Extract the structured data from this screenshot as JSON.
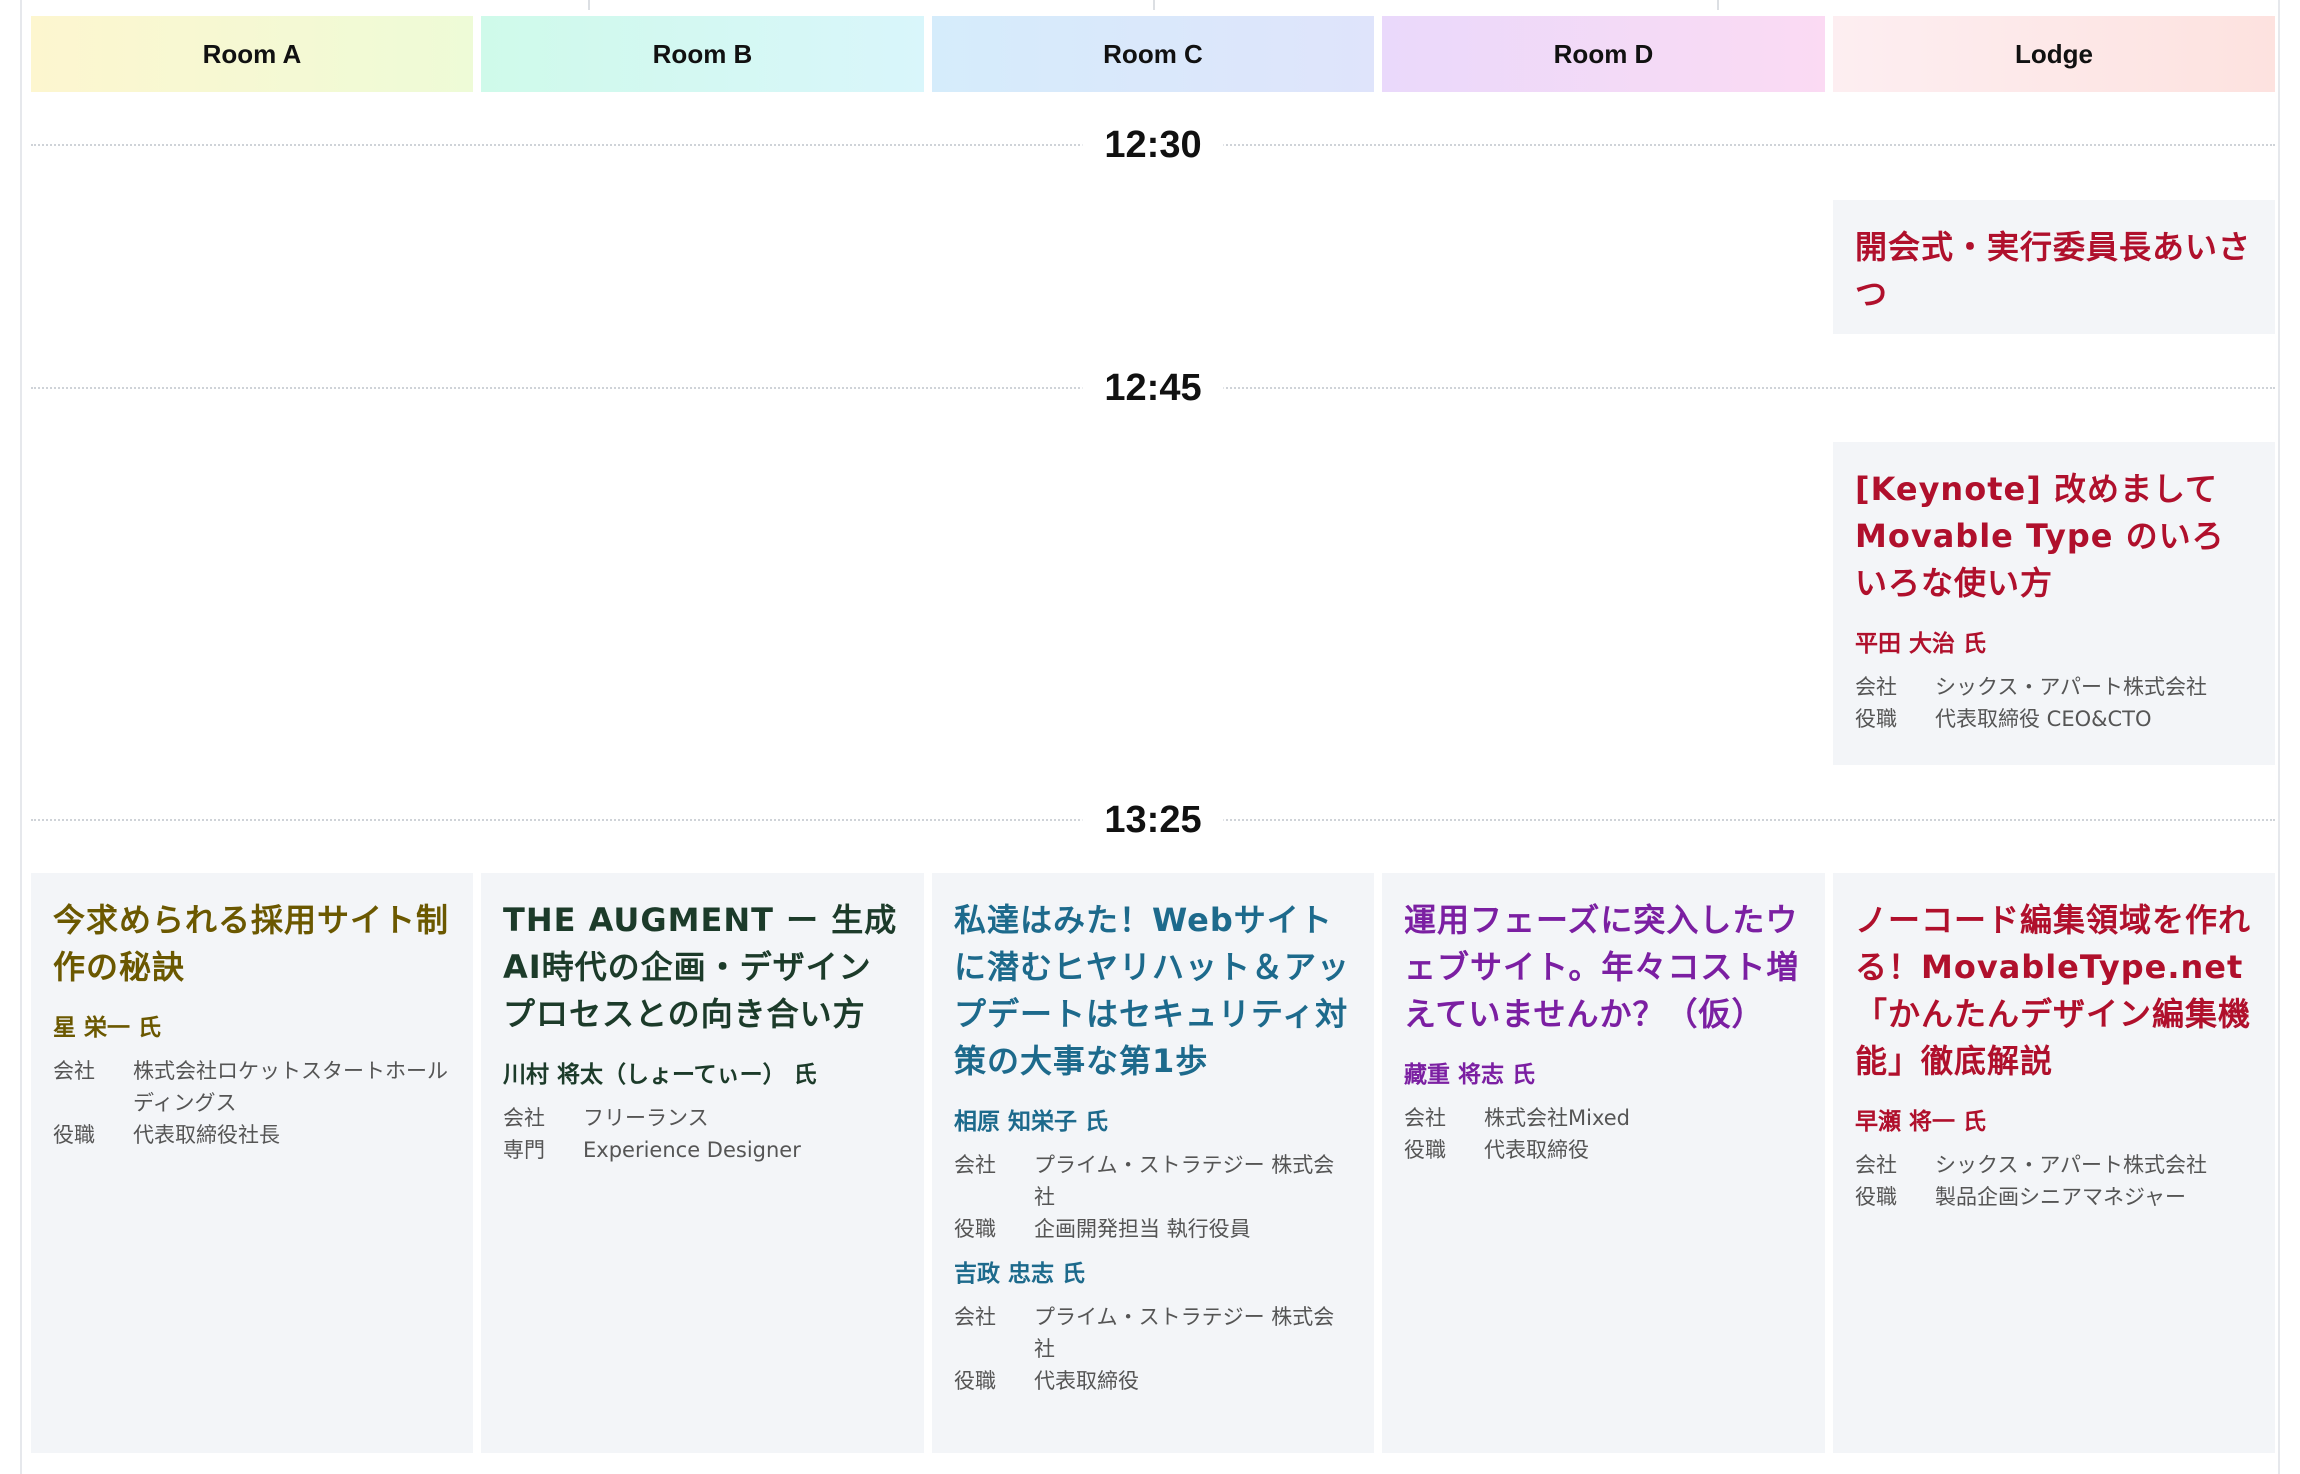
{
  "rooms": [
    "Room A",
    "Room B",
    "Room C",
    "Room D",
    "Lodge"
  ],
  "times": {
    "t1": "12:30",
    "t2": "12:45",
    "t3": "13:25"
  },
  "labels": {
    "company": "会社",
    "position": "役職",
    "specialty": "専門"
  },
  "sessions": {
    "opening": {
      "room": "Lodge",
      "title": "開会式・実行委員長あいさつ"
    },
    "keynote": {
      "room": "Lodge",
      "title": "[Keynote] 改めまして Movable Type のいろいろな使い方",
      "speaker": "平田 大治 氏",
      "company": "シックス・アパート株式会社",
      "position": "代表取締役 CEO&CTO"
    },
    "room_a": {
      "title": "今求められる採用サイト制作の秘訣",
      "speaker": "星 栄一 氏",
      "company": "株式会社ロケットスタートホールディングス",
      "position": "代表取締役社長"
    },
    "room_b": {
      "title": "THE AUGMENT ー 生成AI時代の企画・デザインプロセスとの向き合い方",
      "speaker": "川村 将太（しょーてぃー） 氏",
      "company": "フリーランス",
      "specialty": "Experience Designer"
    },
    "room_c": {
      "title": "私達はみた！Webサイトに潜むヒヤリハット＆アップデートはセキュリティ対策の大事な第1歩",
      "speakers": [
        {
          "name": "相原 知栄子 氏",
          "company": "プライム・ストラテジー 株式会社",
          "position": "企画開発担当 執行役員"
        },
        {
          "name": "吉政 忠志 氏",
          "company": "プライム・ストラテジー 株式会社",
          "position": "代表取締役"
        }
      ]
    },
    "room_d": {
      "title": "運用フェーズに突入したウェブサイト。年々コスト増えていませんか？（仮）",
      "speaker": "藏重 将志 氏",
      "company": "株式会社Mixed",
      "position": "代表取締役"
    },
    "lodge_2": {
      "title": "ノーコード編集領域を作れる！MovableType.net「かんたんデザイン編集機能」徹底解説",
      "speaker": "早瀬 将一 氏",
      "company": "シックス・アパート株式会社",
      "position": "製品企画シニアマネジャー"
    }
  },
  "colors": {
    "room_a_text": "#6b5800",
    "room_b_text": "#1c3b2a",
    "room_c_text": "#1d6a8c",
    "room_d_text": "#7b1fa2",
    "lodge_text": "#b0102c",
    "card_bg": "#f3f5f8"
  }
}
